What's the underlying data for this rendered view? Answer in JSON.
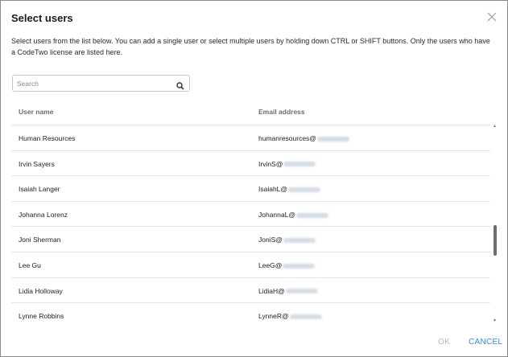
{
  "dialog": {
    "title": "Select users",
    "description": "Select users from the list below. You can add a single user or select multiple users by holding down CTRL or SHIFT buttons. Only the users who have a CodeTwo license are listed here."
  },
  "search": {
    "placeholder": "Search",
    "value": "",
    "icon": "search-icon"
  },
  "table": {
    "columns": [
      "User name",
      "Email address"
    ],
    "rows": [
      {
        "name": "Human Resources",
        "email_prefix": "humanresources@"
      },
      {
        "name": "Irvin Sayers",
        "email_prefix": "IrvinS@"
      },
      {
        "name": "Isaiah Langer",
        "email_prefix": "IsaiahL@"
      },
      {
        "name": "Johanna Lorenz",
        "email_prefix": "JohannaL@"
      },
      {
        "name": "Joni Sherman",
        "email_prefix": "JoniS@"
      },
      {
        "name": "Lee Gu",
        "email_prefix": "LeeG@"
      },
      {
        "name": "Lidia Holloway",
        "email_prefix": "LidiaH@"
      },
      {
        "name": "Lynne Robbins",
        "email_prefix": "LynneR@"
      }
    ]
  },
  "buttons": {
    "ok": "OK",
    "cancel": "CANCEL"
  },
  "colors": {
    "accent": "#2f8fd8",
    "disabled": "#b8b8b8"
  }
}
